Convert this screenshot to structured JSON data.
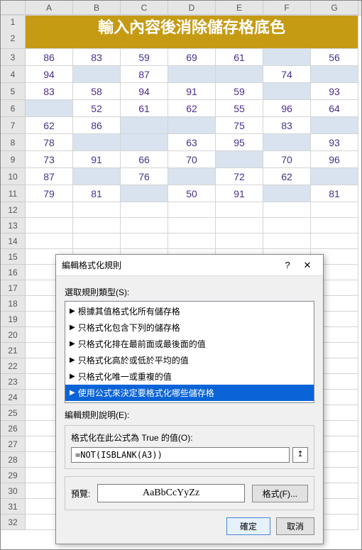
{
  "columns": [
    "A",
    "B",
    "C",
    "D",
    "E",
    "F",
    "G"
  ],
  "title": "輸入內容後消除儲存格底色",
  "grid": [
    [
      86,
      83,
      59,
      69,
      61,
      null,
      56
    ],
    [
      94,
      null,
      87,
      null,
      null,
      74,
      null
    ],
    [
      83,
      58,
      94,
      91,
      59,
      null,
      93
    ],
    [
      null,
      52,
      61,
      62,
      55,
      96,
      64
    ],
    [
      62,
      86,
      null,
      null,
      75,
      83,
      null
    ],
    [
      78,
      null,
      null,
      63,
      95,
      null,
      93
    ],
    [
      73,
      91,
      66,
      70,
      null,
      70,
      96
    ],
    [
      87,
      null,
      76,
      null,
      72,
      62,
      null
    ],
    [
      79,
      81,
      null,
      50,
      91,
      null,
      81
    ]
  ],
  "row_start": 3,
  "dialog": {
    "title": "編輯格式化規則",
    "help": "?",
    "close": "✕",
    "select_rule_type_label": "選取規則類型(S):",
    "rule_types": [
      "根據其值格式化所有儲存格",
      "只格式化包含下列的儲存格",
      "只格式化排在最前面或最後面的值",
      "只格式化高於或低於平均的值",
      "只格式化唯一或重複的值",
      "使用公式來決定要格式化哪些儲存格"
    ],
    "selected_index": 5,
    "edit_desc_label": "編輯規則說明(E):",
    "formula_label": "格式化在此公式為 True 的值(O):",
    "formula_value": "=NOT(ISBLANK(A3))",
    "ref_btn": "↥",
    "preview_label": "預覽:",
    "preview_sample": "AaBbCcYyZz",
    "format_btn": "格式(F)...",
    "ok": "確定",
    "cancel": "取消"
  }
}
